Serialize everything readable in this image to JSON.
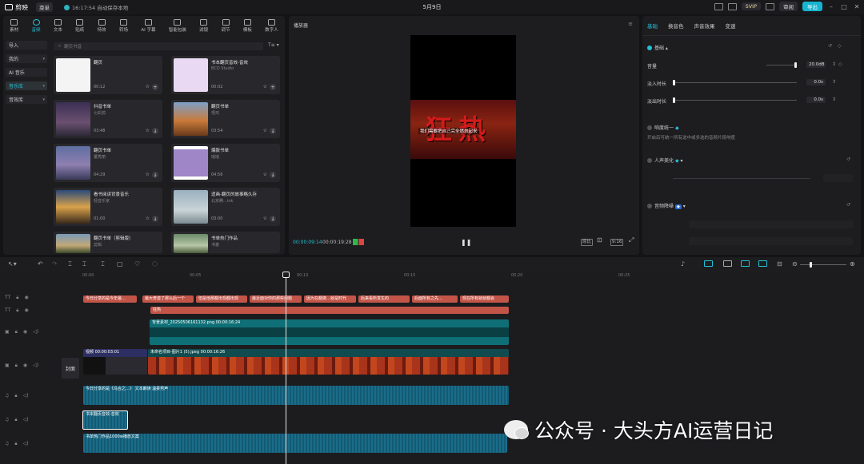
{
  "titlebar": {
    "app_name": "剪映",
    "menu": "菜单",
    "save_status": "16:17:54 自动保存本地",
    "project_title": "5月9日",
    "svip": "SVIP",
    "review": "审阅",
    "export": "导出"
  },
  "categories": [
    "素材",
    "音频",
    "文本",
    "贴纸",
    "特效",
    "转场",
    "AI 字幕",
    "智能包装",
    "滤镜",
    "调节",
    "模板",
    "数字人"
  ],
  "side_nav": [
    {
      "label": "导入",
      "caret": false
    },
    {
      "label": "我的",
      "caret": true
    },
    {
      "label": "AI 音乐",
      "caret": false
    },
    {
      "label": "音乐库",
      "caret": true
    },
    {
      "label": "音效库",
      "caret": true
    }
  ],
  "search": {
    "placeholder": "翻页书音"
  },
  "music_cards": [
    {
      "title": "翻页",
      "subtitle": "",
      "duration": "00:12"
    },
    {
      "title": "书本翻页音效-音效",
      "subtitle": "BCD Studio",
      "duration": "00:02"
    },
    {
      "title": "抖音书单",
      "subtitle": "七彩鸽",
      "duration": "03:48"
    },
    {
      "title": "翻页书单",
      "subtitle": "悟鸡",
      "duration": "03:54"
    },
    {
      "title": "翻页书单",
      "subtitle": "董秀丽",
      "duration": "04:29"
    },
    {
      "title": "爆款书单",
      "subtitle": "瑶瑶",
      "duration": "04:56"
    },
    {
      "title": "看书阅读背景音乐",
      "subtitle": "轻音乐家",
      "duration": "01:00"
    },
    {
      "title": "适画-翻页的故事略久存",
      "subtitle": "北京腾…ink",
      "duration": "03:00"
    },
    {
      "title": "翻页书单（剪辑版）",
      "subtitle": "剪辑",
      "duration": ""
    },
    {
      "title": "书单热门作品",
      "subtitle": "书童",
      "duration": ""
    }
  ],
  "player": {
    "header": "播放器",
    "video_big_text": "狂热",
    "video_caption": "我们需要把自己完全燃烧起来",
    "current_time": "00:00:09:14",
    "total_time": "00:00:19:28",
    "ratio_btn": "原比",
    "aspect_btn": "9:16"
  },
  "props": {
    "tabs": [
      "基础",
      "换音色",
      "声音效果",
      "变速"
    ],
    "section_basic": "基础",
    "volume_label": "音量",
    "volume_value": "20.0dB",
    "volume_level": 0.95,
    "fadein_label": "淡入时长",
    "fadein_value": "0.0s",
    "fadein_level": 0.0,
    "fadeout_label": "淡出时长",
    "fadeout_value": "0.0s",
    "fadeout_level": 0.0,
    "loudness_label": "响度统一",
    "loudness_desc": "开启后可统一所有选中或多选的音频片段响度",
    "beautify_label": "人声美化",
    "denoise_label": "音频降噪"
  },
  "timeline": {
    "ticks": [
      "00:00",
      "00:05",
      "00:10",
      "00:15",
      "00:20",
      "00:25"
    ],
    "text_clips": [
      "今日分享的是今年最…",
      "最大奇迹了那么后一个",
      "但是他那都出现都出现",
      "最近面对你的那些问题",
      "因为在都做…就是时代",
      "后来看所发生的",
      "后面所有之先…",
      "现在所有就就都会"
    ],
    "subtitle_clip": "狂热",
    "image_clip": "背景素材_20250506161132.png  00:00:16:24",
    "main_header_a": "视频  00:00:03:01",
    "main_header_b": "未命名项目-图片1 (5).jpeg  00:00:16:26",
    "cover_label": "封面",
    "music_clip": "今日分享的是《乌合之…》 文本朗读 温柔男声",
    "sfx_clip": "书本翻页音效-音效",
    "bgm_clip": "书单热门作品1000w播放文案"
  },
  "watermark": "公众号 · 大头方AI运营日记"
}
